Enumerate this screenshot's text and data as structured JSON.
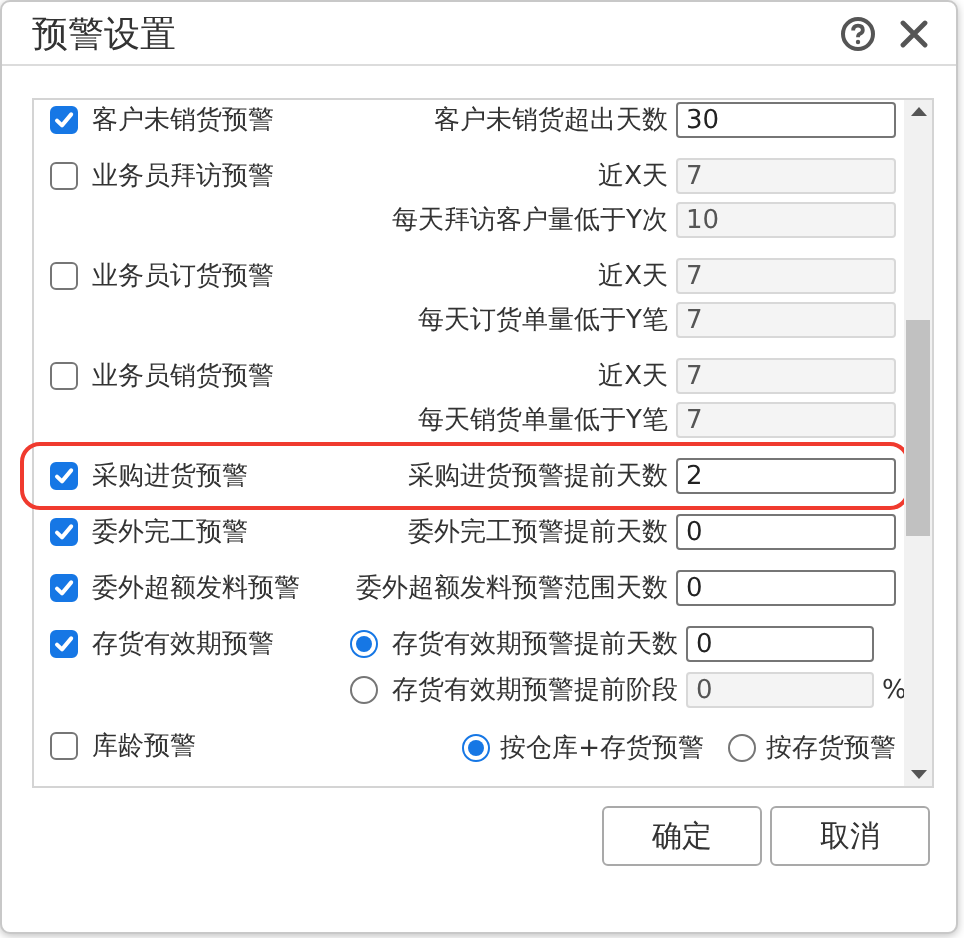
{
  "window": {
    "title": "预警设置"
  },
  "rows": [
    {
      "kind": "fields",
      "label": "客户未销货预警",
      "checked": true,
      "highlighted": false,
      "fields": [
        {
          "label": "客户未销货超出天数",
          "value": "30",
          "disabled": false
        }
      ]
    },
    {
      "kind": "fields",
      "label": "业务员拜访预警",
      "checked": false,
      "highlighted": false,
      "fields": [
        {
          "label": "近X天",
          "value": "7",
          "disabled": true
        },
        {
          "label": "每天拜访客户量低于Y次",
          "value": "10",
          "disabled": true
        }
      ]
    },
    {
      "kind": "fields",
      "label": "业务员订货预警",
      "checked": false,
      "highlighted": false,
      "fields": [
        {
          "label": "近X天",
          "value": "7",
          "disabled": true
        },
        {
          "label": "每天订货单量低于Y笔",
          "value": "7",
          "disabled": true
        }
      ]
    },
    {
      "kind": "fields",
      "label": "业务员销货预警",
      "checked": false,
      "highlighted": false,
      "fields": [
        {
          "label": "近X天",
          "value": "7",
          "disabled": true
        },
        {
          "label": "每天销货单量低于Y笔",
          "value": "7",
          "disabled": true
        }
      ]
    },
    {
      "kind": "fields",
      "label": "采购进货预警",
      "checked": true,
      "highlighted": true,
      "fields": [
        {
          "label": "采购进货预警提前天数",
          "value": "2",
          "disabled": false
        }
      ]
    },
    {
      "kind": "fields",
      "label": "委外完工预警",
      "checked": true,
      "highlighted": false,
      "fields": [
        {
          "label": "委外完工预警提前天数",
          "value": "0",
          "disabled": false
        }
      ]
    },
    {
      "kind": "fields",
      "label": "委外超额发料预警",
      "checked": true,
      "highlighted": false,
      "fields": [
        {
          "label": "委外超额发料预警范围天数",
          "value": "0",
          "disabled": false
        }
      ]
    },
    {
      "kind": "radios",
      "label": "存货有效期预警",
      "checked": true,
      "highlighted": false,
      "options": [
        {
          "label": "存货有效期预警提前天数",
          "selected": true,
          "value": "0",
          "disabled": false
        },
        {
          "label": "存货有效期预警提前阶段",
          "selected": false,
          "value": "0",
          "disabled": true,
          "suffix": "%"
        }
      ]
    },
    {
      "kind": "inline_radios",
      "label": "库龄预警",
      "checked": false,
      "highlighted": false,
      "options": [
        {
          "label": "按仓库+存货预警",
          "selected": true
        },
        {
          "label": "按存货预警",
          "selected": false
        }
      ]
    }
  ],
  "buttons": [
    "确定",
    "取消"
  ]
}
